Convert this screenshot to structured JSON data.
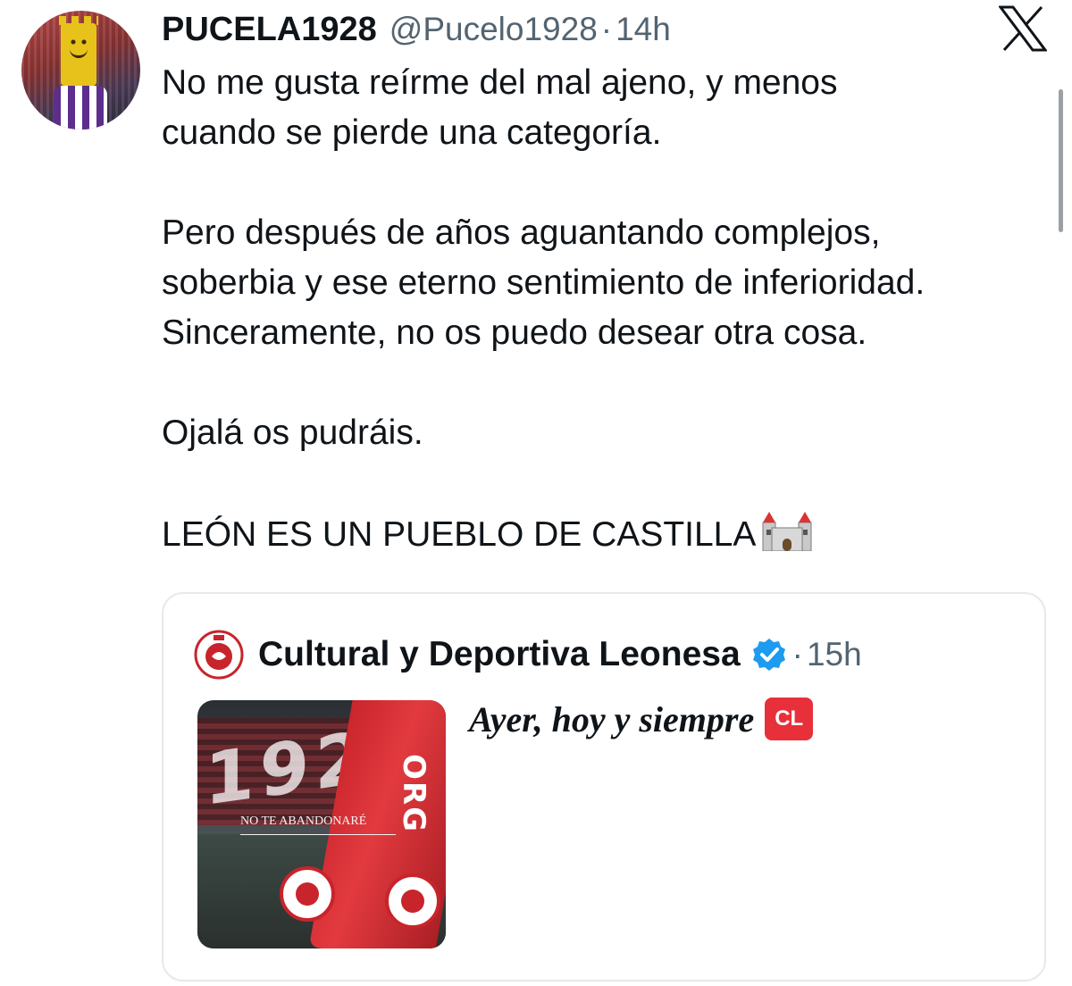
{
  "tweet": {
    "author": {
      "display_name": "PUCELA1928",
      "handle": "@Pucelo1928",
      "separator": "·",
      "time": "14h",
      "avatar_icon": "mascot-avatar-icon"
    },
    "text_paragraphs": [
      {
        "lines": [
          "No me gusta reírme del mal ajeno, y menos",
          "cuando se pierde una categoría."
        ]
      },
      {
        "lines": [
          "Pero después de años aguantando complejos,",
          "soberbia y ese eterno sentimiento de inferioridad.",
          "Sinceramente, no os puedo desear otra cosa."
        ]
      },
      {
        "lines": [
          "Ojalá os pudráis."
        ]
      },
      {
        "lines": [
          "LEÓN ES UN PUEBLO DE CASTILLA"
        ],
        "emoji": "castle-emoji"
      }
    ]
  },
  "quoted_tweet": {
    "author": {
      "display_name": "Cultural y Deportiva Leonesa",
      "verified": true,
      "separator": "·",
      "time": "15h",
      "logo_icon": "club-crest-icon"
    },
    "text": "Ayer, hoy y siempre",
    "emoji_badge": "CL",
    "media": {
      "banner_text": "NO TE ABANDONARÉ",
      "stadium_digits": "192",
      "scarf_text": "ORG"
    }
  },
  "brand": {
    "logo_icon": "x-logo-icon"
  },
  "colors": {
    "text_primary": "#0f1419",
    "text_secondary": "#536471",
    "border": "#e6e9ec",
    "verified_blue": "#1d9bf0",
    "cl_red": "#e8303a",
    "club_red": "#c8242b"
  }
}
